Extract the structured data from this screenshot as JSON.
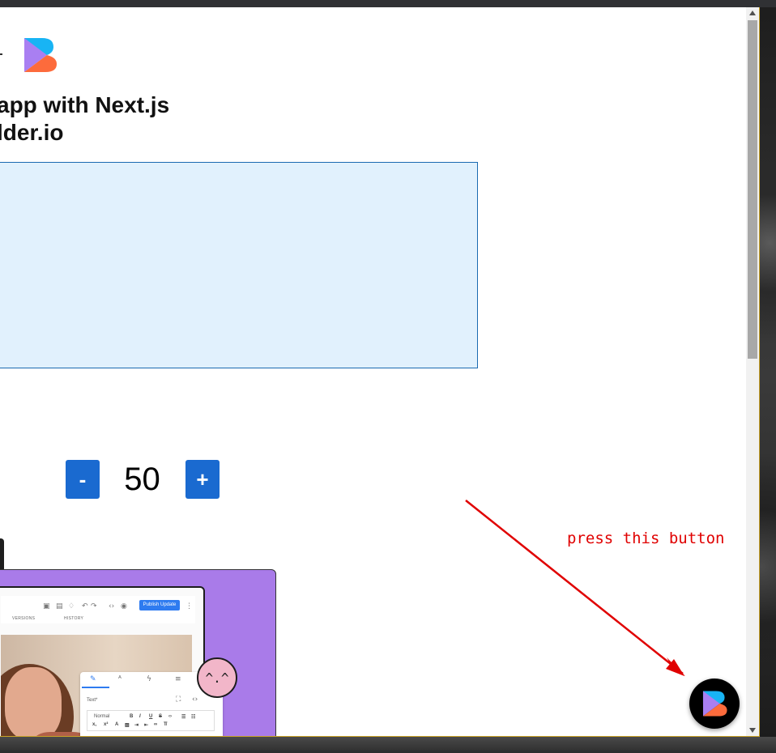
{
  "page": {
    "heading_line1": "app with Next.js",
    "heading_line2": "lder.io"
  },
  "counter": {
    "decrement_label": "-",
    "value": "50",
    "increment_label": "+"
  },
  "preview_card": {
    "publish_label": "Publish Update",
    "tab_versions": "VERSIONS",
    "tab_history": "HISTORY",
    "panel_text_label": "Text*",
    "panel_format_select": "Normal",
    "emoji_face": "^.^"
  },
  "annotation": {
    "text": "press this button",
    "color": "#e00000"
  },
  "colors": {
    "button_blue": "#1a6ad0",
    "box_fill": "#e1f1fd",
    "card_purple": "#a97be9"
  },
  "icons": [
    "builder-logo-icon",
    "scroll-up-icon",
    "scroll-down-icon",
    "builder-fab-icon"
  ]
}
